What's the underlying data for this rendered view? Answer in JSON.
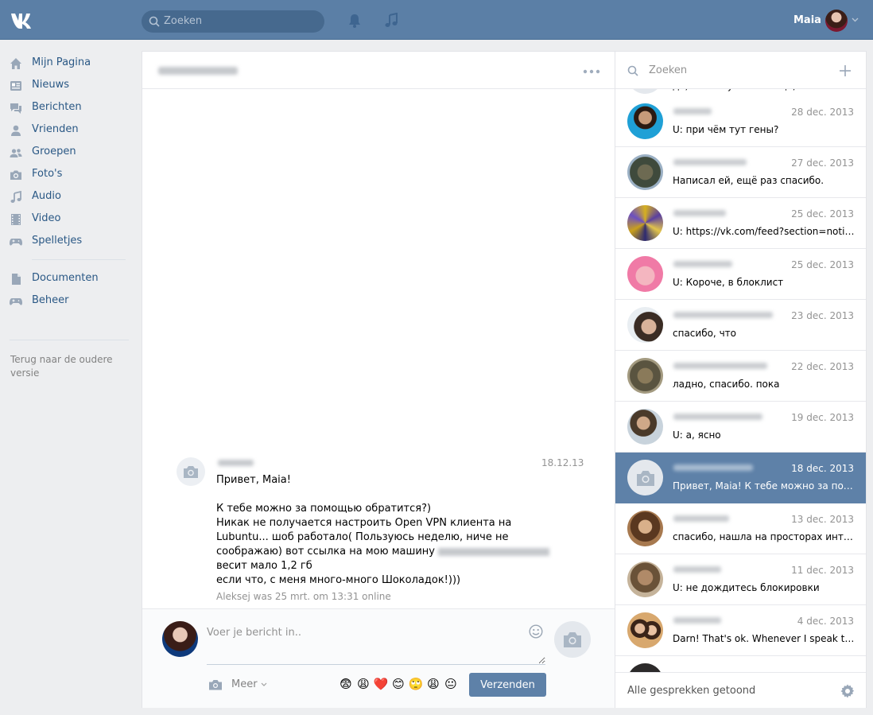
{
  "header": {
    "search_placeholder": "Zoeken",
    "username": "Maia",
    "accent": "#5b7fa6"
  },
  "nav": {
    "items": [
      {
        "label": "Mijn Pagina",
        "icon": "home-icon"
      },
      {
        "label": "Nieuws",
        "icon": "news-icon"
      },
      {
        "label": "Berichten",
        "icon": "messages-icon"
      },
      {
        "label": "Vrienden",
        "icon": "friend-icon"
      },
      {
        "label": "Groepen",
        "icon": "groups-icon"
      },
      {
        "label": "Foto's",
        "icon": "camera-icon"
      },
      {
        "label": "Audio",
        "icon": "music-note-icon"
      },
      {
        "label": "Video",
        "icon": "film-icon"
      },
      {
        "label": "Spelletjes",
        "icon": "gamepad-icon"
      }
    ],
    "items2": [
      {
        "label": "Documenten",
        "icon": "document-icon"
      },
      {
        "label": "Beheer",
        "icon": "gamepad-icon"
      }
    ],
    "old_version": "Terug naar de oudere versie"
  },
  "chat": {
    "message": {
      "date": "18.12.13",
      "lines": [
        "Привет, Maia!",
        "",
        "К тебе можно за помощью обратится?)",
        "Никак не получается настроить Open VPN клиента на",
        "Lubuntu... шоб работало( Пользуюсь неделю, ниче не",
        "соображаю) вот ссылка на мою машину",
        "весит мало 1,2 гб",
        "если что, с меня много-много Шоколадок!)))"
      ]
    },
    "status": "Aleksej was 25 mrt. om 13:31 online",
    "compose_placeholder": "Voer je bericht in..",
    "more_label": "Meer",
    "emojis": [
      "😨",
      "😩",
      "❤️",
      "😊",
      "🙄",
      "😩",
      "😐"
    ],
    "send_label": "Verzenden"
  },
  "conversations": {
    "search_placeholder": "Zoeken",
    "partial_preview": "да, всего хуже. Вообще, не все...",
    "items": [
      {
        "date": "28 dec. 2013",
        "preview": "U: при чём тут гены?"
      },
      {
        "date": "27 dec. 2013",
        "preview": "Написал ей, ещё раз спасибо."
      },
      {
        "date": "25 dec. 2013",
        "preview": "U: https://vk.com/feed?section=notifications"
      },
      {
        "date": "25 dec. 2013",
        "preview": "U: Короче, в блоклист"
      },
      {
        "date": "23 dec. 2013",
        "preview": "спасибо, что"
      },
      {
        "date": "22 dec. 2013",
        "preview": "ладно, спасибо. пока"
      },
      {
        "date": "19 dec. 2013",
        "preview": "U: а, ясно"
      },
      {
        "date": "18 dec. 2013",
        "preview": "Привет, Maia! К тебе можно за помощью обратится?)",
        "selected": true
      },
      {
        "date": "13 dec. 2013",
        "preview": "спасибо, нашла на просторах интернета"
      },
      {
        "date": "11 dec. 2013",
        "preview": "U: не дождитесь блокировки"
      },
      {
        "date": "4 dec. 2013",
        "preview": "Darn! That's ok. Whenever I speak to you..."
      }
    ],
    "footer": "Alle gesprekken getoond"
  }
}
